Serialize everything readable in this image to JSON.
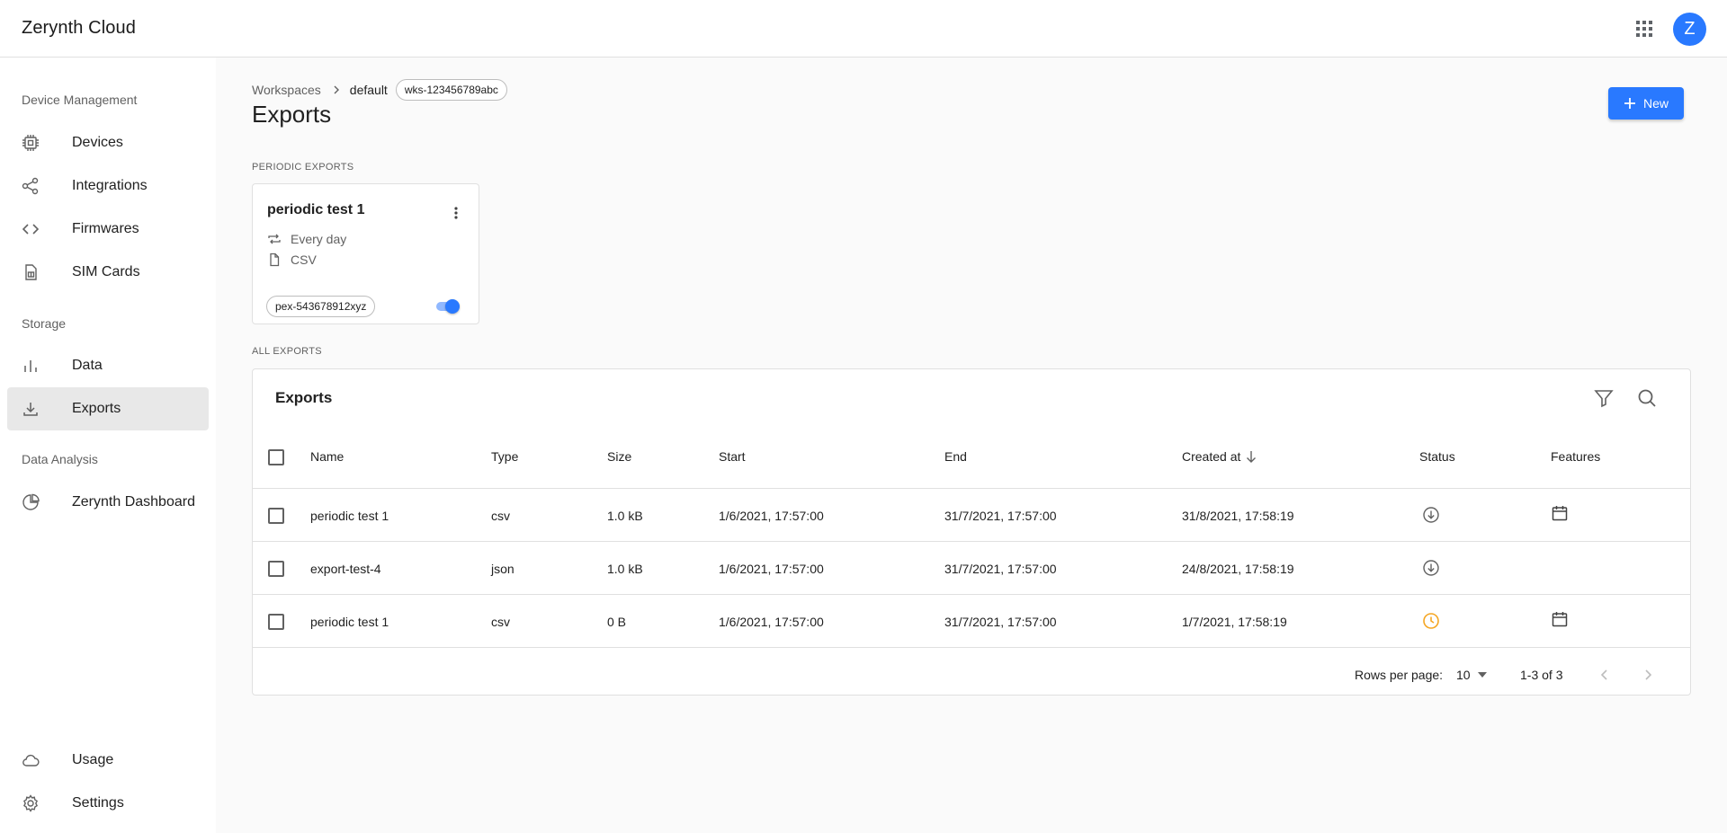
{
  "app": {
    "title": "Zerynth Cloud",
    "avatar_letter": "Z",
    "accent": "#2979ff"
  },
  "header": {
    "apps_icon": "grid-apps-icon"
  },
  "sidebar": {
    "sections": [
      {
        "title": "Device Management",
        "items": [
          {
            "label": "Devices",
            "icon": "chip-icon"
          },
          {
            "label": "Integrations",
            "icon": "share-icon"
          },
          {
            "label": "Firmwares",
            "icon": "code-icon"
          },
          {
            "label": "SIM Cards",
            "icon": "sim-card-icon"
          }
        ]
      },
      {
        "title": "Storage",
        "items": [
          {
            "label": "Data",
            "icon": "bar-chart-icon"
          },
          {
            "label": "Exports",
            "icon": "download-icon",
            "active": true
          }
        ]
      },
      {
        "title": "Data Analysis",
        "items": [
          {
            "label": "Zerynth Dashboard",
            "icon": "pie-chart-icon"
          }
        ]
      }
    ],
    "bottom_items": [
      {
        "label": "Usage",
        "icon": "cloud-icon"
      },
      {
        "label": "Settings",
        "icon": "gear-icon"
      }
    ]
  },
  "breadcrumb": {
    "root": "Workspaces",
    "current": "default",
    "workspace_id": "wks-123456789abc"
  },
  "page": {
    "title": "Exports",
    "new_button": "New"
  },
  "periodic": {
    "section_title": "PERIODIC EXPORTS",
    "cards": [
      {
        "title": "periodic test 1",
        "frequency": "Every day",
        "format": "CSV",
        "id": "pex-543678912xyz",
        "enabled": true
      }
    ]
  },
  "all_exports": {
    "section_title": "ALL EXPORTS",
    "table_title": "Exports",
    "columns": [
      "Name",
      "Type",
      "Size",
      "Start",
      "End",
      "Created at",
      "Status",
      "Features"
    ],
    "sort_column": "Created at",
    "sort_direction": "desc",
    "rows": [
      {
        "name": "periodic test 1",
        "type": "csv",
        "size": "1.0 kB",
        "start": "1/6/2021, 17:57:00",
        "end": "31/7/2021, 17:57:00",
        "created": "31/8/2021, 17:58:19",
        "status": "download-icon",
        "feature": "calendar-icon"
      },
      {
        "name": "export-test-4",
        "type": "json",
        "size": "1.0 kB",
        "start": "1/6/2021, 17:57:00",
        "end": "31/7/2021, 17:57:00",
        "created": "24/8/2021, 17:58:19",
        "status": "download-icon",
        "feature": ""
      },
      {
        "name": "periodic test 1",
        "type": "csv",
        "size": "0 B",
        "start": "1/6/2021, 17:57:00",
        "end": "31/7/2021, 17:57:00",
        "created": "1/7/2021, 17:58:19",
        "status": "clock-icon",
        "feature": "calendar-icon"
      }
    ],
    "status_colors": {
      "download-icon": "#616161",
      "clock-icon": "#f5a623"
    },
    "pagination": {
      "rows_per_page_label": "Rows per page:",
      "rows_per_page": "10",
      "range": "1-3 of 3"
    }
  }
}
